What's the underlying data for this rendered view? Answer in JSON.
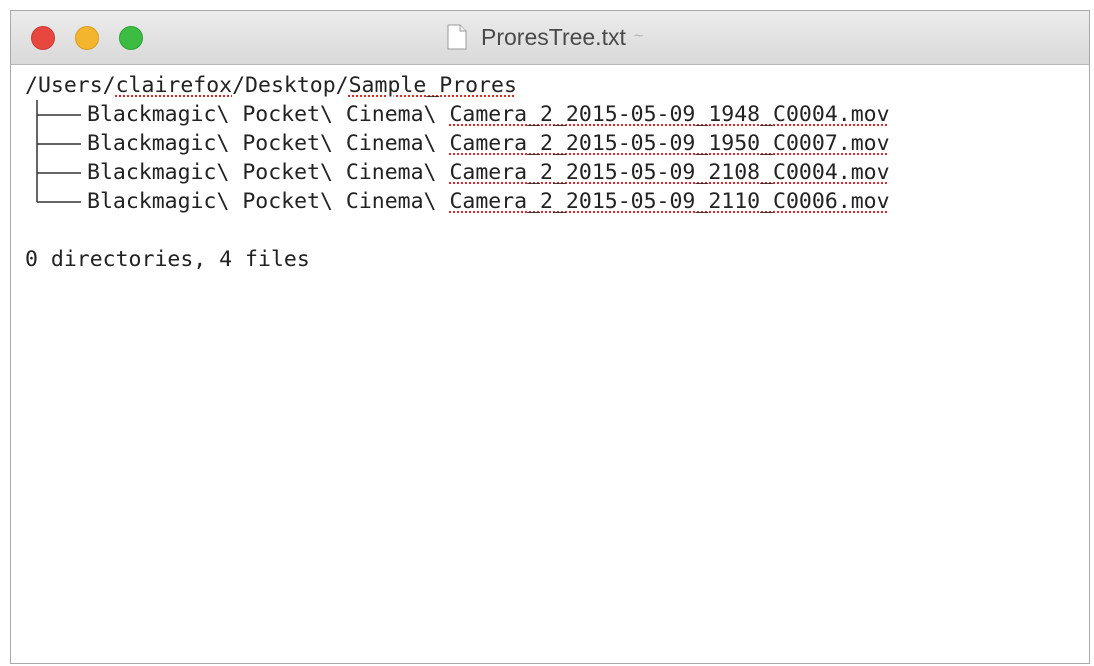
{
  "window": {
    "title": "ProresTree.txt",
    "title_suffix": "~"
  },
  "document": {
    "path_prefix": "/Users/",
    "path_user": "clairefox",
    "path_middle": "/Desktop/",
    "path_folder": "Sample_Prores",
    "files": [
      {
        "prefix": "Blackmagic\\ Pocket\\ Cinema\\ ",
        "name": "Camera_2_2015-05-09_1948_C0004.mov"
      },
      {
        "prefix": "Blackmagic\\ Pocket\\ Cinema\\ ",
        "name": "Camera_2_2015-05-09_1950_C0007.mov"
      },
      {
        "prefix": "Blackmagic\\ Pocket\\ Cinema\\ ",
        "name": "Camera_2_2015-05-09_2108_C0004.mov"
      },
      {
        "prefix": "Blackmagic\\ Pocket\\ Cinema\\ ",
        "name": "Camera_2_2015-05-09_2110_C0006.mov"
      }
    ],
    "summary": "0 directories, 4 files"
  },
  "icons": {
    "close": "close-button",
    "minimize": "minimize-button",
    "zoom": "zoom-button",
    "document": "document-icon"
  },
  "colors": {
    "close": "#e8473f",
    "minimize": "#f4b52e",
    "zoom": "#3dbc43",
    "spellcheck_underline": "#e2262c"
  }
}
